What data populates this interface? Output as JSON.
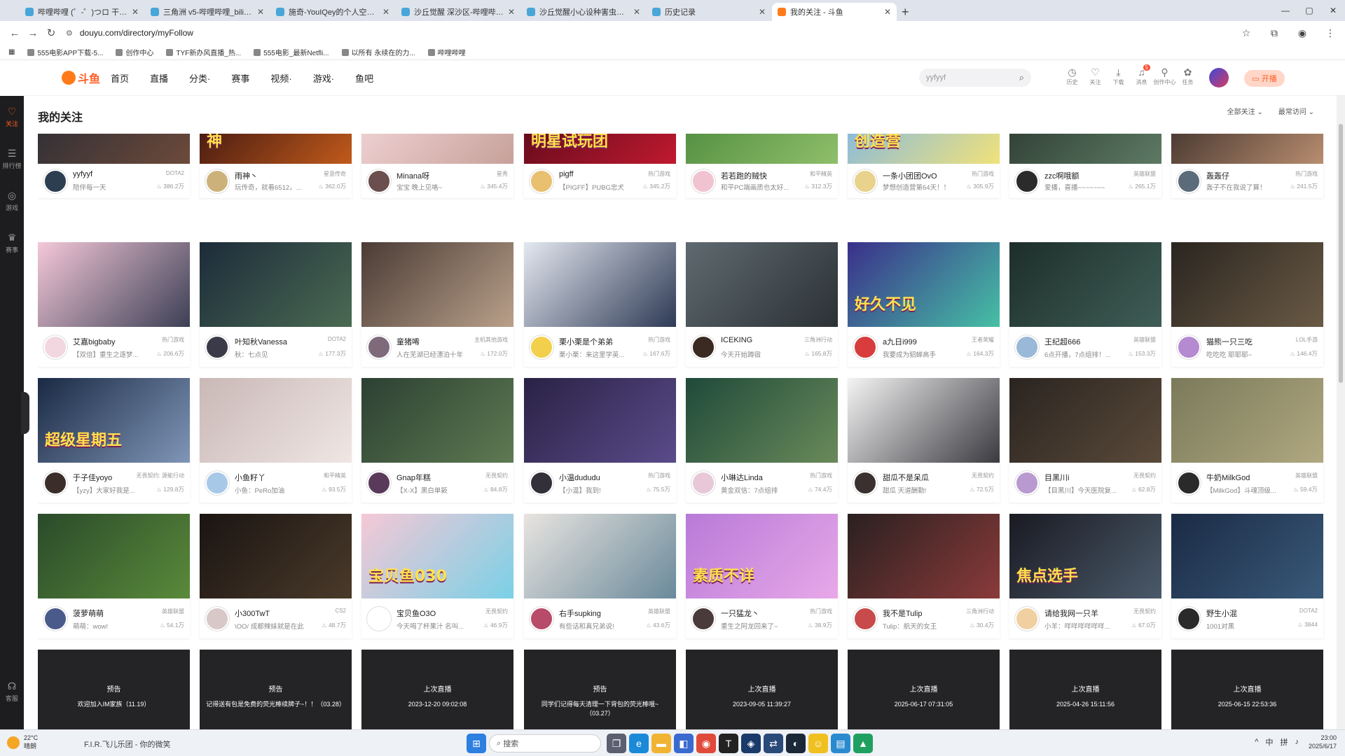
{
  "browser": {
    "tabs": [
      {
        "title": "哔哩哔哩 (゜-゜)つロ 干杯~-bi",
        "active": false
      },
      {
        "title": "三角洲 v5-哔哩哔哩_bilibili",
        "active": false
      },
      {
        "title": "施奇-YouIQey的个人空间-施奇",
        "active": false
      },
      {
        "title": "沙丘觉醒 深沙区-哔哩哔哩_bili",
        "active": false
      },
      {
        "title": "沙丘觉醒小心设种害虫田_游戏",
        "active": false
      },
      {
        "title": "历史记录",
        "active": false
      },
      {
        "title": "我的关注 - 斗鱼",
        "active": true
      }
    ],
    "new_tab": "+",
    "window_controls": [
      "—",
      "▢",
      "✕"
    ],
    "url": "douyu.com/directory/myFollow",
    "bookmarks": [
      "555电影APP下载-5...",
      "创作中心",
      "TYF新办风直播_热...",
      "555电影_最新Netfli...",
      "以所有 永续在的力...",
      "哔哩哔哩"
    ]
  },
  "rail": {
    "items": [
      {
        "icon": "♡",
        "label": "关注",
        "active": true
      },
      {
        "icon": "☰",
        "label": "排行榜",
        "active": false
      },
      {
        "icon": "◎",
        "label": "游戏",
        "active": false
      },
      {
        "icon": "♛",
        "label": "赛事",
        "active": false
      }
    ],
    "bottom": {
      "icon": "☊",
      "label": "客服"
    }
  },
  "header": {
    "logo": "斗鱼",
    "nav": [
      "首页",
      "直播",
      "分类·",
      "赛事",
      "视频·",
      "游戏·",
      "鱼吧"
    ],
    "search_placeholder": "yyfyyf",
    "icons": [
      {
        "icon": "◷",
        "label": "历史",
        "badge": ""
      },
      {
        "icon": "♡",
        "label": "关注",
        "badge": ""
      },
      {
        "icon": "⤓",
        "label": "下载",
        "badge": ""
      },
      {
        "icon": "♫",
        "label": "消息",
        "badge": "5"
      },
      {
        "icon": "⚲",
        "label": "创作中心",
        "badge": ""
      },
      {
        "icon": "✿",
        "label": "任务",
        "badge": ""
      }
    ],
    "open_live": "开播"
  },
  "page": {
    "title": "我的关注",
    "filter_all": "全部关注 ⌄",
    "filter_recent": "最常访问 ⌄"
  },
  "rows": [
    [
      {
        "name": "yyfyyf",
        "category": "DOTA2",
        "desc": "陪伴每一天",
        "hot": "386.2万",
        "thumb": [
          "#2b2d35",
          "#6d4a3a"
        ],
        "avatar": "#2c3e50"
      },
      {
        "name": "雨神丶",
        "category": "星意传奇",
        "desc": "玩传奇，就看6512，...",
        "hot": "362.0万",
        "thumb": [
          "#3a1410",
          "#c15a1b"
        ],
        "avatar": "#ccb27a",
        "text": "神"
      },
      {
        "name": "Minana呀",
        "category": "星秀",
        "desc": "宝宝 晚上见咯~",
        "hot": "345.4万",
        "thumb": [
          "#f3d6d8",
          "#c7a19a"
        ],
        "avatar": "#6b4f4f"
      },
      {
        "name": "pigff",
        "category": "热门游戏",
        "desc": "【PIGFF】PUBG忠犬",
        "hot": "345.2万",
        "thumb": [
          "#5a0a1a",
          "#c0192f"
        ],
        "avatar": "#e8c070",
        "text": "明星试玩团"
      },
      {
        "name": "若若跑的贼快",
        "category": "和平精英",
        "desc": "和平PC端画质也太好...",
        "hot": "312.3万",
        "thumb": [
          "#4e8a3e",
          "#8fbf6a"
        ],
        "avatar": "#f1c3d0"
      },
      {
        "name": "一条小团团OvO",
        "category": "热门游戏",
        "desc": "梦想创造营第64天！！",
        "hot": "305.9万",
        "thumb": [
          "#7fb6e6",
          "#f0e27a"
        ],
        "avatar": "#e8d28c",
        "text": "创造营"
      },
      {
        "name": "zzc啊哦额",
        "category": "英雄联盟",
        "desc": "爱播，喜播~~~~~~~",
        "hot": "265.1万",
        "thumb": [
          "#2c3a30",
          "#5d7a64"
        ],
        "avatar": "#2b2b2b"
      },
      {
        "name": "轰轰仔",
        "category": "热门游戏",
        "desc": "轰子不在我说了算！",
        "hot": "241.5万",
        "thumb": [
          "#3c2f2a",
          "#b88d6f"
        ],
        "avatar": "#5b6b7a"
      }
    ],
    [
      {
        "name": "艾嘉bigbaby",
        "category": "热门游戏",
        "desc": "【双倍】重生之逐梦...",
        "hot": "206.6万",
        "thumb": [
          "#f4c8d8",
          "#3c3f55"
        ],
        "avatar": "#f2d6e0"
      },
      {
        "name": "叶知秋Vanessa",
        "category": "DOTA2",
        "desc": "秋：七点见",
        "hot": "177.3万",
        "thumb": [
          "#1c2b3a",
          "#4a6a52"
        ],
        "avatar": "#3a3a48"
      },
      {
        "name": "童猪唏",
        "category": "主机其他游戏",
        "desc": "人在芜湖已经漂泊十年",
        "hot": "172.0万",
        "thumb": [
          "#4a3b35",
          "#b9a08a"
        ],
        "avatar": "#7e6a7a"
      },
      {
        "name": "栗小栗是个弟弟",
        "category": "热门游戏",
        "desc": "栗小栗：来这里学英...",
        "hot": "167.6万",
        "thumb": [
          "#e4e8f0",
          "#2e3a55"
        ],
        "avatar": "#f3d04c"
      },
      {
        "name": "ICEKING",
        "category": "三角洲行动",
        "desc": "今天开始蹲宿",
        "hot": "165.8万",
        "thumb": [
          "#5f6a70",
          "#2b3135"
        ],
        "avatar": "#3a2a22"
      },
      {
        "name": "a九日i999",
        "category": "王者荣耀",
        "desc": "我要成为貂蝉高手",
        "hot": "164.3万",
        "thumb": [
          "#3a2f8a",
          "#46c0a5"
        ],
        "avatar": "#d83c3c",
        "text": "好久不见"
      },
      {
        "name": "王纪超666",
        "category": "英雄联盟",
        "desc": "6点开播，7点组排！...",
        "hot": "153.3万",
        "thumb": [
          "#1d2e2a",
          "#3f5d56"
        ],
        "avatar": "#9ab8d8"
      },
      {
        "name": "猫熊一只三吃",
        "category": "LOL手游",
        "desc": "吃吃吃 耶耶耶~",
        "hot": "146.4万",
        "thumb": [
          "#2a2520",
          "#6a5a45"
        ],
        "avatar": "#b58ad0"
      }
    ],
    [
      {
        "name": "于子佳yoyo",
        "category": "无畏契约: 源能行动",
        "desc": "【yzy】大家好我是...",
        "hot": "129.8万",
        "thumb": [
          "#1a2a44",
          "#8096b8"
        ],
        "avatar": "#3b2e2a",
        "text": "超级星期五"
      },
      {
        "name": "小鱼籽丫",
        "category": "和平精英",
        "desc": "小鱼：PeRo加油",
        "hot": "93.5万",
        "thumb": [
          "#c9b8b6",
          "#efe6e4"
        ],
        "avatar": "#a8c8e8"
      },
      {
        "name": "Gnap年糕",
        "category": "无畏契约",
        "desc": "【X-X】黑白单簌",
        "hot": "84.8万",
        "thumb": [
          "#2c4032",
          "#5e7a52"
        ],
        "avatar": "#5a3a5a"
      },
      {
        "name": "小温dududu",
        "category": "热门游戏",
        "desc": "【小温】我到!",
        "hot": "75.5万",
        "thumb": [
          "#2a2245",
          "#5a4b8a"
        ],
        "avatar": "#33303a"
      },
      {
        "name": "小琳达Linda",
        "category": "热门游戏",
        "desc": "黄金双信：7点组排",
        "hot": "74.4万",
        "thumb": [
          "#1f4a3a",
          "#6a8a5a"
        ],
        "avatar": "#e8c8d8"
      },
      {
        "name": "甜瓜不是呆瓜",
        "category": "无畏契约",
        "desc": "甜瓜 天道酬勤!",
        "hot": "72.5万",
        "thumb": [
          "#f4f4f4",
          "#3a3a40"
        ],
        "avatar": "#3a3030"
      },
      {
        "name": "目黑川i",
        "category": "无畏契约",
        "desc": "【目黑川】今天医院复...",
        "hot": "62.8万",
        "thumb": [
          "#2a2420",
          "#5a4a3a"
        ],
        "avatar": "#b89ad0"
      },
      {
        "name": "牛奶MilkGod",
        "category": "英雄联盟",
        "desc": "【MilkGod】斗魂顶级...",
        "hot": "59.4万",
        "thumb": [
          "#7a7a5a",
          "#b0a880"
        ],
        "avatar": "#2a2a2a"
      }
    ],
    [
      {
        "name": "菠萝萌萌",
        "category": "英雄联盟",
        "desc": "萌萌：wow!",
        "hot": "54.1万",
        "thumb": [
          "#2a4a2a",
          "#5a8a3a"
        ],
        "avatar": "#4a5a8a"
      },
      {
        "name": "小300TwT",
        "category": "CS2",
        "desc": "\\OO/ 成都辣妹就是在此",
        "hot": "48.7万",
        "thumb": [
          "#1a1412",
          "#4a3a2a"
        ],
        "avatar": "#d8c8c8"
      },
      {
        "name": "宝贝鱼O3O",
        "category": "无畏契约",
        "desc": "今天喝了杯果汁 名叫...",
        "hot": "46.9万",
        "thumb": [
          "#f6c8d6",
          "#7ad0e6"
        ],
        "avatar": "#ffffff",
        "text": "宝贝鱼030"
      },
      {
        "name": "右手supking",
        "category": "英雄联盟",
        "desc": "有些话和真兄弟说!",
        "hot": "43.6万",
        "thumb": [
          "#e8e4e0",
          "#6a8a9a"
        ],
        "avatar": "#b84a6a"
      },
      {
        "name": "一只猛龙丶",
        "category": "热门游戏",
        "desc": "重生之阿龙回来了~",
        "hot": "38.9万",
        "thumb": [
          "#b87ad8",
          "#e8a8e8"
        ],
        "avatar": "#4a3a3a",
        "text": "素质不详"
      },
      {
        "name": "我不是Tulip",
        "category": "三角洲行动",
        "desc": "Tulip：航天的女王",
        "hot": "30.4万",
        "thumb": [
          "#2a2020",
          "#8a3a3a"
        ],
        "avatar": "#c84a4a"
      },
      {
        "name": "请给我网一只羊",
        "category": "无畏契约",
        "desc": "小羊：咩咩咩咩咩咩...",
        "hot": "67.0万",
        "thumb": [
          "#1a1a22",
          "#4a5a6a"
        ],
        "avatar": "#f0d0a0",
        "text": "焦点选手"
      },
      {
        "name": "野生小混",
        "category": "DOTA2",
        "desc": "1001对黑",
        "hot": "3844",
        "thumb": [
          "#1a2a44",
          "#3a5a7a"
        ],
        "avatar": "#2a2a2a"
      }
    ],
    [
      {
        "status": "预告",
        "text": "欢迎加入IM家族（11.19）"
      },
      {
        "status": "预告",
        "text": "记得送有包是免费的荧光棒续牌子~！！（03.28）"
      },
      {
        "status": "上次直播",
        "text": "2023-12-20 09:02:08"
      },
      {
        "status": "预告",
        "text": "同学们记得每天清理一下背包的荧光棒哦~（03.27）"
      },
      {
        "status": "上次直播",
        "text": "2023-09-05 11:39:27"
      },
      {
        "status": "上次直播",
        "text": "2025-06-17 07:31:05"
      },
      {
        "status": "上次直播",
        "text": "2025-04-26 15:11:56"
      },
      {
        "status": "上次直播",
        "text": "2025-06-15 22:53:36"
      }
    ]
  ],
  "taskbar": {
    "weather_temp": "22°C",
    "weather_desc": "晴朗",
    "now_playing": "F.I.R.飞儿乐团 - 你的微笑",
    "search": "搜索",
    "tray": [
      "^",
      "中",
      "拼",
      "♪"
    ],
    "time": "23:00",
    "date": "2025/6/17"
  }
}
